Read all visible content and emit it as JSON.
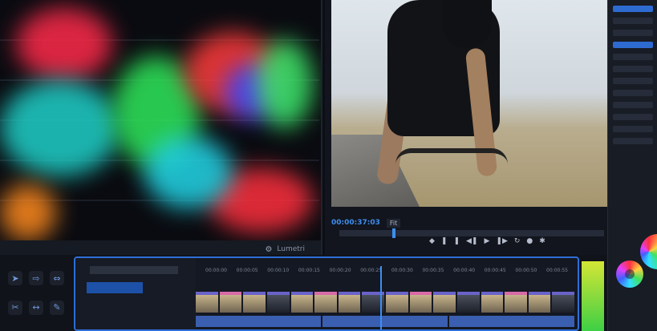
{
  "scope_panel": {
    "footer_label": "Lumetri"
  },
  "monitor": {
    "timecode": "00:00:37:03",
    "fit_label": "Fit",
    "playhead_fraction": 0.2
  },
  "timeline": {
    "ruler_ticks": [
      "00:00:00",
      "00:00:05",
      "00:00:10",
      "00:00:15",
      "00:00:20",
      "00:00:25",
      "00:00:30",
      "00:00:35",
      "00:00:40",
      "00:00:45",
      "00:00:50",
      "00:00:55"
    ]
  },
  "colors": {
    "accent": "#3d8ef0",
    "timeline_border": "#2d6fd6",
    "meter_top": "#d4e635",
    "meter_bottom": "#3ecf45"
  },
  "icons": {
    "transport": [
      "marker-icon",
      "in-point-icon",
      "out-point-icon",
      "step-back-icon",
      "play-icon",
      "step-forward-icon",
      "loop-icon",
      "camera-icon",
      "settings-icon"
    ]
  }
}
